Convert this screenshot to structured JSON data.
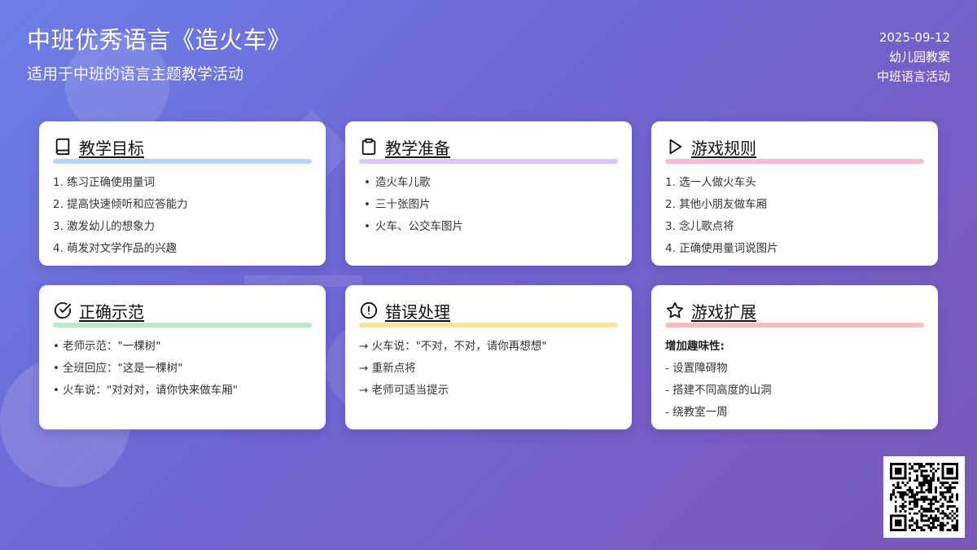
{
  "header": {
    "title": "中班优秀语言《造火车》",
    "subtitle": "适用于中班的语言主题教学活动",
    "date": "2025-09-12",
    "category": "幼儿园教案",
    "tag": "中班语言活动"
  },
  "colors": {
    "objective": "#b7d4f5",
    "prep": "#dcc5f7",
    "rules": "#f6bcd6",
    "correct": "#b8eac4",
    "errors": "#f7e6a0",
    "extension": "#f6bcbc"
  },
  "cards": {
    "objective": {
      "title": "教学目标",
      "icon": "book-icon",
      "items": [
        "1. 练习正确使用量词",
        "2. 提高快速倾听和应答能力",
        "3. 激发幼儿的想象力",
        "4. 萌发对文学作品的兴趣"
      ]
    },
    "prep": {
      "title": "教学准备",
      "icon": "clipboard-icon",
      "items": [
        "造火车儿歌",
        "三十张图片",
        "火车、公交车图片"
      ]
    },
    "rules": {
      "title": "游戏规则",
      "icon": "play-icon",
      "items": [
        "1. 选一人做火车头",
        "2. 其他小朋友做车厢",
        "3. 念儿歌点将",
        "4. 正确使用量词说图片"
      ]
    },
    "correct": {
      "title": "正确示范",
      "icon": "check-circle-icon",
      "items": [
        "老师示范：\"一棵树\"",
        "全班回应：\"这是一棵树\"",
        "火车说：\"对对对，请你快来做车厢\""
      ]
    },
    "errors": {
      "title": "错误处理",
      "icon": "alert-circle-icon",
      "items": [
        "→ 火车说：\"不对，不对，请你再想想\"",
        "→ 重新点将",
        "→ 老师可适当提示"
      ]
    },
    "extension": {
      "title": "游戏扩展",
      "icon": "star-icon",
      "heading": "增加趣味性:",
      "items": [
        "- 设置障碍物",
        "- 搭建不同高度的山洞",
        "- 绕教室一周"
      ]
    }
  }
}
